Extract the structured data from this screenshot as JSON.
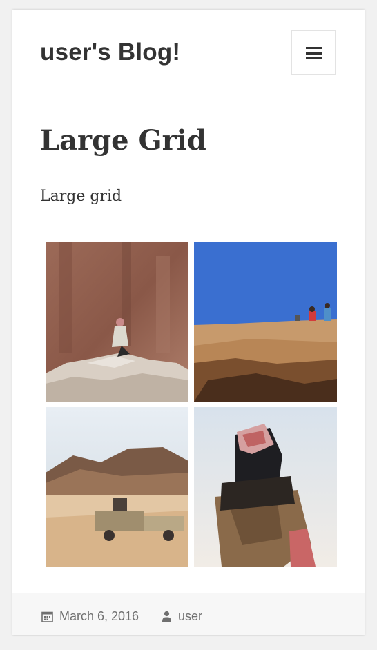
{
  "site": {
    "title": "user's Blog!"
  },
  "header": {
    "menu_icon": "hamburger-menu-icon"
  },
  "post": {
    "title": "Large Grid",
    "body": "Large grid",
    "gallery": [
      {
        "subject": "Person in keffiyeh crouching on rock ledge against brown cliff"
      },
      {
        "subject": "People standing atop sandstone cliff under blue sky"
      },
      {
        "subject": "Pickup truck driving across desert sand with mountains behind"
      },
      {
        "subject": "Rider in red-and-white keffiyeh seated on camel"
      }
    ]
  },
  "footer": {
    "date": "March 6, 2016",
    "author": "user",
    "date_icon": "calendar-icon",
    "author_icon": "user-icon"
  }
}
